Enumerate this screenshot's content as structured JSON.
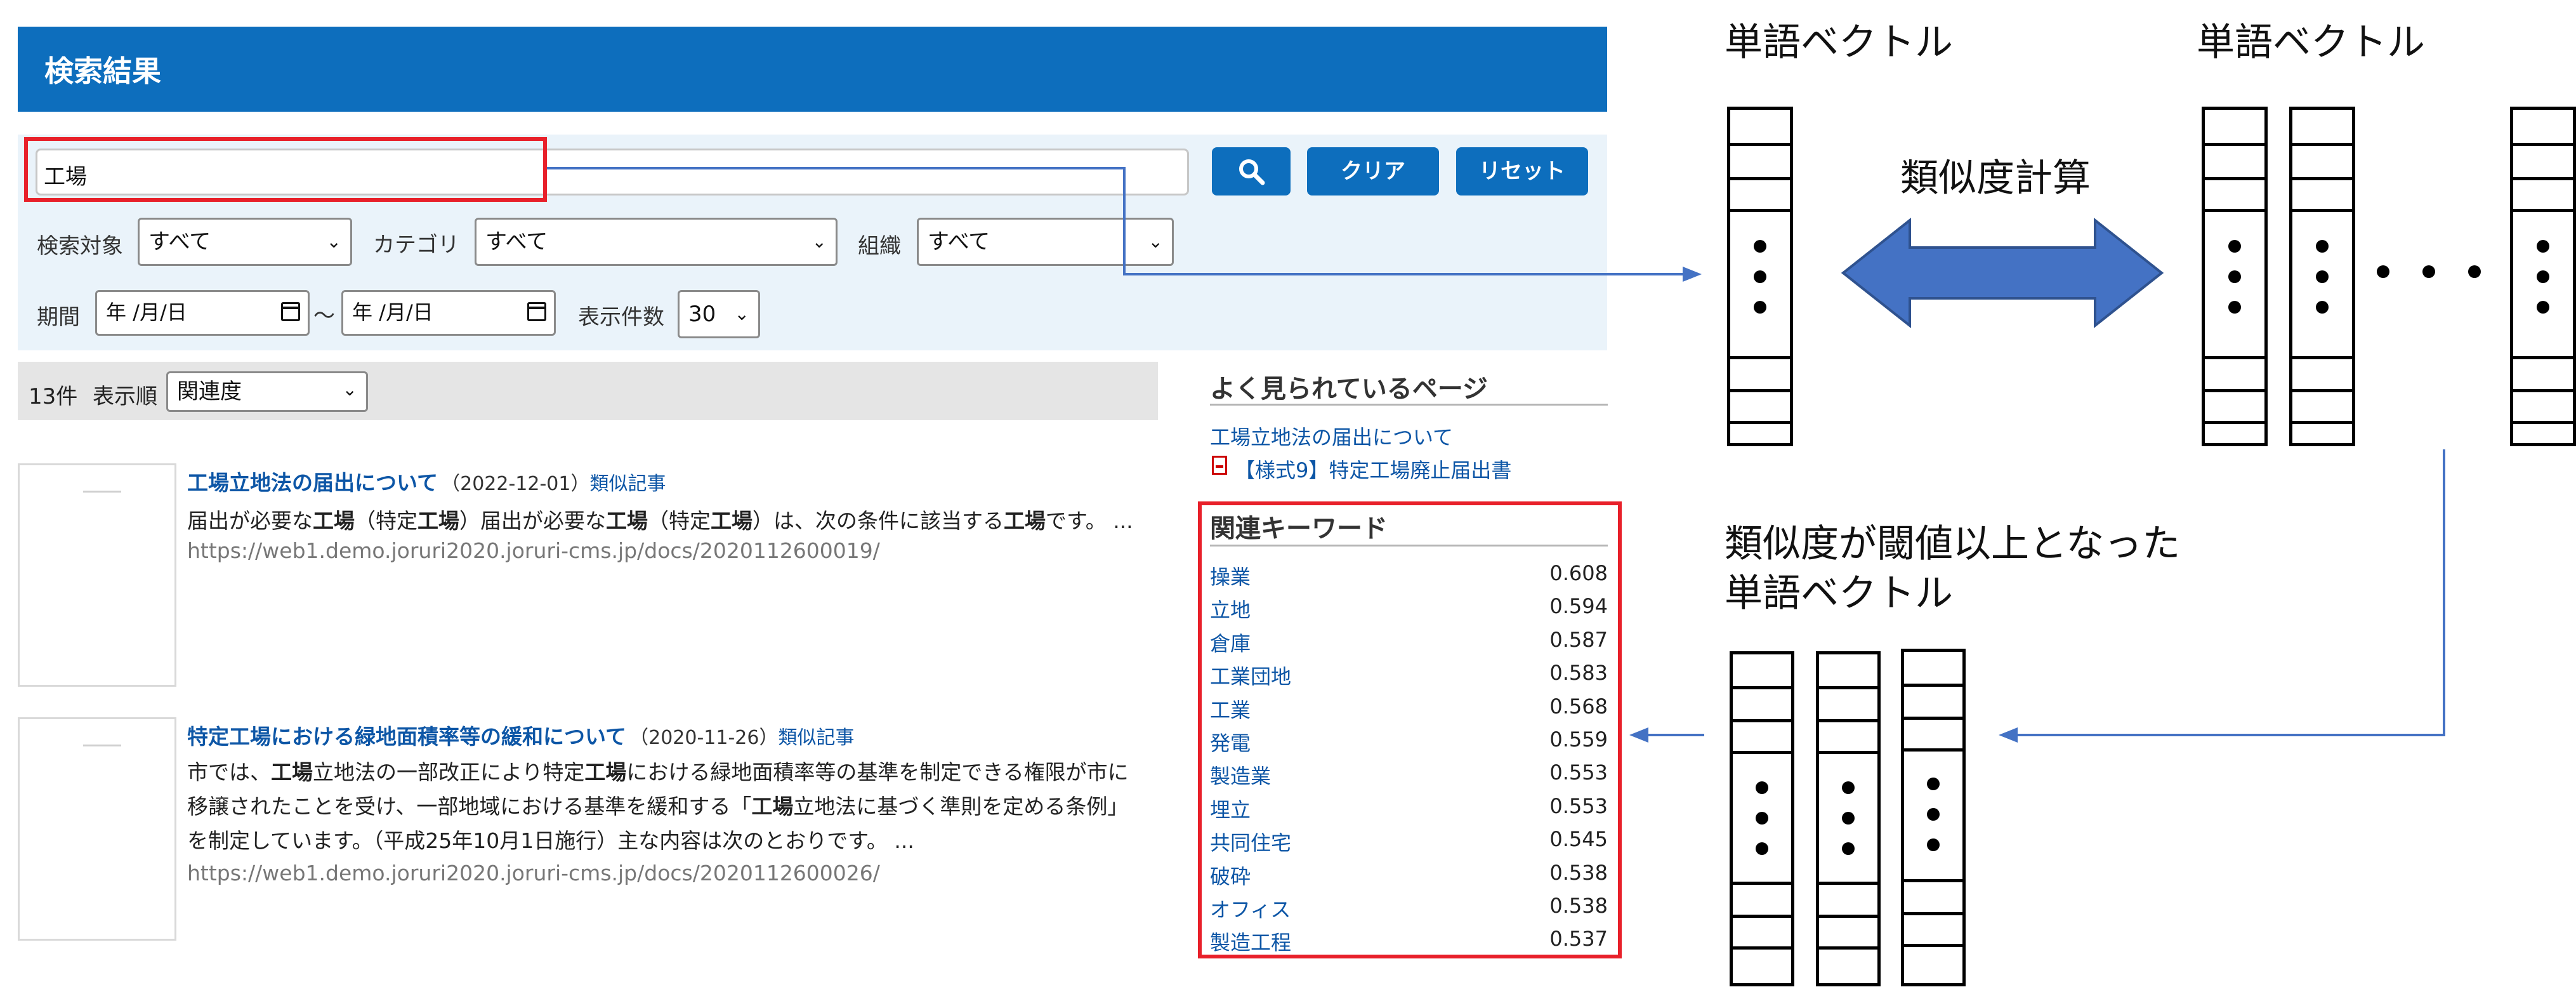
{
  "search": {
    "header_title": "検索結果",
    "query": "工場",
    "search_icon": "magnifier-icon",
    "clear_label": "クリア",
    "reset_label": "リセット",
    "target_label": "検索対象",
    "target_value": "すべて",
    "category_label": "カテゴリ",
    "category_value": "すべて",
    "org_label": "組織",
    "org_value": "すべて",
    "period_label": "期間",
    "date_from_placeholder": "年 /月/日",
    "date_to_placeholder": "年 /月/日",
    "date_sep": "～",
    "count_label": "表示件数",
    "count_value": "30"
  },
  "results_bar": {
    "count": "13件",
    "sort_label": "表示順",
    "sort_value": "関連度"
  },
  "results": [
    {
      "title": "工場立地法の届出について",
      "date": "（2022-12-01）",
      "similar": "類似記事",
      "snippet": [
        [
          [
            "届出が必要な",
            false
          ],
          [
            "工場",
            true
          ],
          [
            "（特定",
            false
          ],
          [
            "工場",
            true
          ],
          [
            "）届出が必要な",
            false
          ],
          [
            "工場",
            true
          ],
          [
            "（特定",
            false
          ],
          [
            "工場",
            true
          ],
          [
            "）は、次の条件に該当する",
            false
          ],
          [
            "工場",
            true
          ],
          [
            "です。 ...",
            false
          ]
        ]
      ],
      "url": "https://web1.demo.joruri2020.joruri-cms.jp/docs/2020112600019/"
    },
    {
      "title": "特定工場における緑地面積率等の緩和について",
      "date": "（2020-11-26）",
      "similar": "類似記事",
      "snippet": [
        [
          [
            "市では、",
            false
          ],
          [
            "工場",
            true
          ],
          [
            "立地法の一部改正により特定",
            false
          ],
          [
            "工場",
            true
          ],
          [
            "における緑地面積率等の基準を制定できる権限が市に",
            false
          ]
        ],
        [
          [
            "移譲されたことを受け、一部地域における基準を緩和する「",
            false
          ],
          [
            "工場",
            true
          ],
          [
            "立地法に基づく準則を定める条例」",
            false
          ]
        ],
        [
          [
            "を制定しています。（平成25年10月1日施行）主な内容は次のとおりです。 ...",
            false
          ]
        ]
      ],
      "url": "https://web1.demo.joruri2020.joruri-cms.jp/docs/2020112600026/"
    }
  ],
  "popular": {
    "heading": "よく見られているページ",
    "items": [
      {
        "label": "工場立地法の届出について",
        "icon": ""
      },
      {
        "label": "【様式9】特定工場廃止届出書",
        "icon": "pdf-icon"
      }
    ]
  },
  "keywords": {
    "heading": "関連キーワード",
    "items": [
      {
        "word": "操業",
        "score": "0.608"
      },
      {
        "word": "立地",
        "score": "0.594"
      },
      {
        "word": "倉庫",
        "score": "0.587"
      },
      {
        "word": "工業団地",
        "score": "0.583"
      },
      {
        "word": "工業",
        "score": "0.568"
      },
      {
        "word": "発電",
        "score": "0.559"
      },
      {
        "word": "製造業",
        "score": "0.553"
      },
      {
        "word": "埋立",
        "score": "0.553"
      },
      {
        "word": "共同住宅",
        "score": "0.545"
      },
      {
        "word": "破砕",
        "score": "0.538"
      },
      {
        "word": "オフィス",
        "score": "0.538"
      },
      {
        "word": "製造工程",
        "score": "0.537"
      }
    ]
  },
  "diagram": {
    "left_vector_label": "単語ベクトル",
    "right_vector_label": "単語ベクトル",
    "similarity_label": "類似度計算",
    "result_label_line1": "類似度が閾値以上となった",
    "result_label_line2": "単語ベクトル",
    "highlight_color": "#e8202a",
    "arrow_color": "#4472c4",
    "double_arrow_fill": "#4472c4",
    "double_arrow_stroke": "#2f528f"
  }
}
